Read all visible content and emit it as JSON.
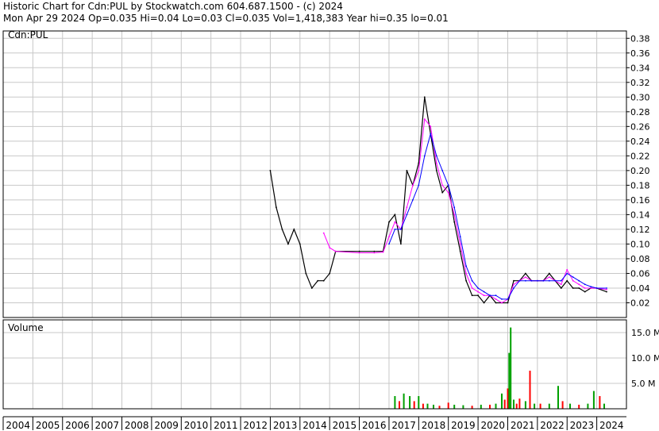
{
  "header": {
    "line1": "Historic Chart for Cdn:PUL by Stockwatch.com 604.687.1500 - (c) 2024",
    "line2": "Mon Apr 29 2024   Op=0.035  Hi=0.04  Lo=0.03  Cl=0.035  Vol=1,418,383  Year hi=0.35  lo=0.01"
  },
  "colors": {
    "price": "#000000",
    "ma_short": "#ff00ff",
    "ma_long": "#0000ff",
    "vol_up": "#00a000",
    "vol_down": "#ff0000",
    "grid": "#c8c8c8"
  },
  "chart_data": [
    {
      "type": "line",
      "panel": "price",
      "label": "Cdn:PUL",
      "x_labels": [
        "2004",
        "2005",
        "2006",
        "2007",
        "2008",
        "2009",
        "2010",
        "2011",
        "2012",
        "2013",
        "2014",
        "2015",
        "2016",
        "2017",
        "2018",
        "2019",
        "2020",
        "2021",
        "2022",
        "2023",
        "2024"
      ],
      "ylim": [
        0.0,
        0.39
      ],
      "y_ticks": [
        "0.38",
        "0.36",
        "0.34",
        "0.32",
        "0.30",
        "0.28",
        "0.26",
        "0.24",
        "0.22",
        "0.20",
        "0.18",
        "0.16",
        "0.14",
        "0.12",
        "0.10",
        "0.08",
        "0.06",
        "0.04",
        "0.02"
      ],
      "series": [
        {
          "key": "price",
          "x": [
            2013.0,
            2013.2,
            2013.4,
            2013.6,
            2013.8,
            2014.0,
            2014.2,
            2014.4,
            2014.6,
            2014.8,
            2015.0,
            2015.2,
            2016.0,
            2016.5,
            2016.8,
            2017.0,
            2017.2,
            2017.4,
            2017.6,
            2017.8,
            2018.0,
            2018.2,
            2018.4,
            2018.6,
            2018.8,
            2019.0,
            2019.2,
            2019.4,
            2019.6,
            2019.8,
            2020.0,
            2020.2,
            2020.4,
            2020.6,
            2020.8,
            2021.0,
            2021.2,
            2021.4,
            2021.6,
            2021.8,
            2022.0,
            2022.2,
            2022.4,
            2022.6,
            2022.8,
            2023.0,
            2023.2,
            2023.4,
            2023.6,
            2023.8,
            2024.0,
            2024.33
          ],
          "y": [
            0.2,
            0.15,
            0.12,
            0.1,
            0.12,
            0.1,
            0.06,
            0.04,
            0.05,
            0.05,
            0.06,
            0.09,
            0.09,
            0.09,
            0.09,
            0.13,
            0.14,
            0.1,
            0.2,
            0.18,
            0.21,
            0.3,
            0.25,
            0.2,
            0.17,
            0.18,
            0.13,
            0.09,
            0.05,
            0.03,
            0.03,
            0.02,
            0.03,
            0.02,
            0.02,
            0.02,
            0.05,
            0.05,
            0.06,
            0.05,
            0.05,
            0.05,
            0.06,
            0.05,
            0.04,
            0.05,
            0.04,
            0.04,
            0.035,
            0.04,
            0.04,
            0.035
          ]
        },
        {
          "key": "ma_short",
          "x": [
            2014.8,
            2015.0,
            2015.2,
            2016.0,
            2016.5,
            2016.8,
            2017.0,
            2017.2,
            2017.4,
            2017.6,
            2017.8,
            2018.0,
            2018.2,
            2018.4,
            2018.6,
            2018.8,
            2019.0,
            2019.2,
            2019.4,
            2019.6,
            2019.8,
            2020.0,
            2020.2,
            2020.4,
            2020.6,
            2020.8,
            2021.0,
            2021.2,
            2021.4,
            2021.6,
            2021.8,
            2022.0,
            2022.2,
            2022.4,
            2022.6,
            2022.8,
            2023.0,
            2023.2,
            2023.4,
            2023.6,
            2023.8,
            2024.0,
            2024.33
          ],
          "y": [
            0.115,
            0.095,
            0.09,
            0.088,
            0.088,
            0.089,
            0.11,
            0.13,
            0.12,
            0.15,
            0.18,
            0.2,
            0.27,
            0.26,
            0.21,
            0.18,
            0.17,
            0.14,
            0.1,
            0.06,
            0.04,
            0.035,
            0.03,
            0.03,
            0.025,
            0.02,
            0.025,
            0.045,
            0.05,
            0.055,
            0.05,
            0.05,
            0.05,
            0.055,
            0.05,
            0.045,
            0.065,
            0.05,
            0.045,
            0.04,
            0.04,
            0.04,
            0.038
          ]
        },
        {
          "key": "ma_long",
          "x": [
            2017.0,
            2017.2,
            2017.4,
            2017.6,
            2017.8,
            2018.0,
            2018.2,
            2018.4,
            2018.6,
            2018.8,
            2019.0,
            2019.2,
            2019.4,
            2019.6,
            2019.8,
            2020.0,
            2020.2,
            2020.4,
            2020.6,
            2020.8,
            2021.0,
            2021.2,
            2021.4,
            2021.6,
            2021.8,
            2022.0,
            2022.2,
            2022.4,
            2022.6,
            2022.8,
            2023.0,
            2023.2,
            2023.4,
            2023.6,
            2023.8,
            2024.0,
            2024.33
          ],
          "y": [
            0.1,
            0.12,
            0.12,
            0.14,
            0.16,
            0.18,
            0.22,
            0.25,
            0.22,
            0.2,
            0.18,
            0.15,
            0.11,
            0.07,
            0.05,
            0.04,
            0.035,
            0.03,
            0.03,
            0.025,
            0.025,
            0.04,
            0.05,
            0.05,
            0.05,
            0.05,
            0.05,
            0.05,
            0.05,
            0.05,
            0.06,
            0.055,
            0.05,
            0.045,
            0.042,
            0.04,
            0.04
          ]
        }
      ]
    },
    {
      "type": "bar",
      "panel": "volume",
      "label": "Volume",
      "ylim": [
        0,
        17.5
      ],
      "y_ticks": [
        "15.0 M",
        "10.0 M",
        "5.0 M"
      ],
      "bars": [
        {
          "x": 2017.2,
          "v": 2.5,
          "up": true
        },
        {
          "x": 2017.35,
          "v": 1.5,
          "up": false
        },
        {
          "x": 2017.5,
          "v": 3.0,
          "up": true
        },
        {
          "x": 2017.7,
          "v": 2.5,
          "up": true
        },
        {
          "x": 2017.85,
          "v": 1.5,
          "up": false
        },
        {
          "x": 2018.0,
          "v": 2.5,
          "up": true
        },
        {
          "x": 2018.15,
          "v": 1.0,
          "up": false
        },
        {
          "x": 2018.3,
          "v": 1.0,
          "up": true
        },
        {
          "x": 2018.5,
          "v": 0.8,
          "up": true
        },
        {
          "x": 2018.7,
          "v": 0.6,
          "up": false
        },
        {
          "x": 2019.0,
          "v": 1.2,
          "up": false
        },
        {
          "x": 2019.2,
          "v": 0.8,
          "up": true
        },
        {
          "x": 2019.5,
          "v": 0.7,
          "up": true
        },
        {
          "x": 2019.8,
          "v": 0.6,
          "up": false
        },
        {
          "x": 2020.1,
          "v": 0.8,
          "up": true
        },
        {
          "x": 2020.4,
          "v": 0.8,
          "up": false
        },
        {
          "x": 2020.6,
          "v": 1.0,
          "up": true
        },
        {
          "x": 2020.8,
          "v": 3.0,
          "up": true
        },
        {
          "x": 2020.9,
          "v": 1.8,
          "up": false
        },
        {
          "x": 2021.0,
          "v": 4.0,
          "up": false
        },
        {
          "x": 2021.05,
          "v": 11.0,
          "up": true
        },
        {
          "x": 2021.1,
          "v": 16.0,
          "up": true
        },
        {
          "x": 2021.2,
          "v": 1.8,
          "up": true
        },
        {
          "x": 2021.3,
          "v": 1.0,
          "up": false
        },
        {
          "x": 2021.4,
          "v": 2.0,
          "up": false
        },
        {
          "x": 2021.6,
          "v": 1.5,
          "up": true
        },
        {
          "x": 2021.75,
          "v": 7.5,
          "up": false
        },
        {
          "x": 2021.9,
          "v": 1.0,
          "up": true
        },
        {
          "x": 2022.1,
          "v": 1.0,
          "up": false
        },
        {
          "x": 2022.4,
          "v": 1.0,
          "up": true
        },
        {
          "x": 2022.7,
          "v": 4.5,
          "up": true
        },
        {
          "x": 2022.85,
          "v": 1.5,
          "up": false
        },
        {
          "x": 2023.1,
          "v": 1.0,
          "up": true
        },
        {
          "x": 2023.4,
          "v": 0.8,
          "up": false
        },
        {
          "x": 2023.7,
          "v": 1.0,
          "up": true
        },
        {
          "x": 2023.9,
          "v": 3.5,
          "up": true
        },
        {
          "x": 2024.1,
          "v": 2.5,
          "up": false
        },
        {
          "x": 2024.25,
          "v": 1.0,
          "up": true
        }
      ]
    }
  ]
}
